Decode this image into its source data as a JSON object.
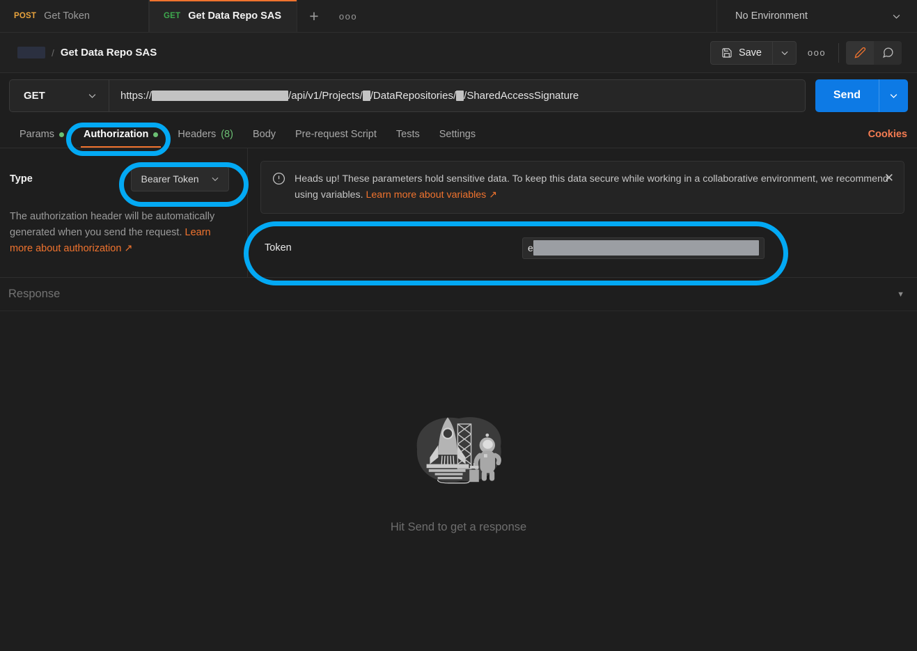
{
  "tabs": {
    "items": [
      {
        "method": "POST",
        "title": "Get Token",
        "active": false,
        "unsaved": false
      },
      {
        "method": "GET",
        "title": "Get Data Repo SAS",
        "active": true,
        "unsaved": true
      }
    ],
    "new_tab_icon": "plus-icon",
    "more_icon": "ellipsis-icon",
    "environment": "No Environment",
    "environment_caret": "chevron-down-icon"
  },
  "header": {
    "breadcrumb_redacted": "",
    "breadcrumb_separator": "/",
    "title": "Get Data Repo SAS",
    "save_label": "Save",
    "save_icon": "floppy-disk-icon",
    "save_caret_icon": "chevron-down-icon",
    "more_icon": "ellipsis-icon",
    "edit_icon": "pencil-icon",
    "comment_icon": "comment-icon"
  },
  "url_bar": {
    "method": "GET",
    "method_caret_icon": "chevron-down-icon",
    "url_prefix": "https://",
    "url_part_1": "/api/v1/Projects/",
    "url_part_2": "/DataRepositories/",
    "url_part_3": "/SharedAccessSignature",
    "send_label": "Send",
    "send_caret_icon": "chevron-down-icon"
  },
  "request_tabs": {
    "items": [
      {
        "label": "Params",
        "dot": true,
        "count": "",
        "active": false
      },
      {
        "label": "Authorization",
        "dot": true,
        "count": "",
        "active": true
      },
      {
        "label": "Headers",
        "dot": false,
        "count": "(8)",
        "active": false
      },
      {
        "label": "Body",
        "dot": false,
        "count": "",
        "active": false
      },
      {
        "label": "Pre-request Script",
        "dot": false,
        "count": "",
        "active": false
      },
      {
        "label": "Tests",
        "dot": false,
        "count": "",
        "active": false
      },
      {
        "label": "Settings",
        "dot": false,
        "count": "",
        "active": false
      }
    ],
    "cookies_label": "Cookies"
  },
  "auth": {
    "type_label": "Type",
    "type_value": "Bearer Token",
    "type_caret_icon": "chevron-down-icon",
    "description_prefix": "The authorization header will be automatically generated when you send the request. ",
    "description_link": "Learn more about authorization ↗",
    "warning_icon": "alert-circle-icon",
    "warning_text": "Heads up! These parameters hold sensitive data. To keep this data secure while working in a collaborative environment, we recommend using variables. ",
    "warning_link": "Learn more about variables ↗",
    "warning_close_icon": "close-icon",
    "token_label": "Token",
    "token_value_prefix": "e",
    "token_value_redacted": ""
  },
  "response": {
    "label": "Response",
    "caret_icon": "caret-down-icon",
    "illustration": "rocket-launch-astronaut-illustration",
    "empty_message": "Hit Send to get a response"
  },
  "annotations": {
    "color": "#03a9f4",
    "items": [
      {
        "name": "authorization-tab-highlight",
        "shape": "rounded-rect"
      },
      {
        "name": "bearer-token-dropdown-highlight",
        "shape": "rounded-rect"
      },
      {
        "name": "token-field-highlight",
        "shape": "rounded-rect"
      }
    ]
  },
  "colors": {
    "background": "#1e1e1e",
    "panel": "#212121",
    "accent_orange": "#f0732e",
    "send_blue": "#0d7ae5",
    "get_green": "#3ea94e",
    "post_yellow": "#e8a33d",
    "annotation_cyan": "#03a9f4"
  }
}
